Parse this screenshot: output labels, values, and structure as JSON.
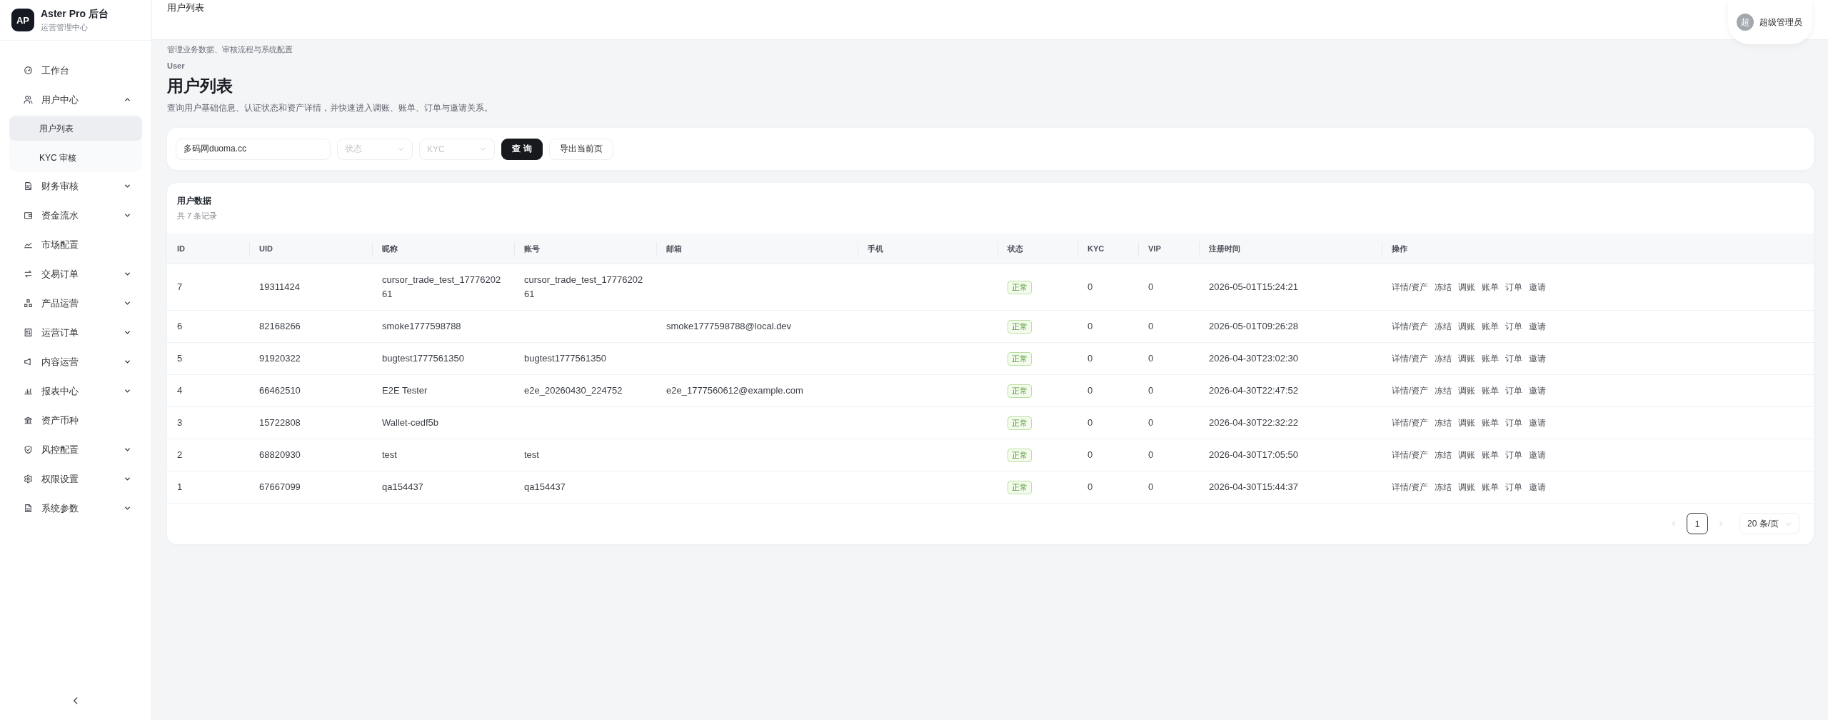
{
  "sidebar": {
    "logo": "AP",
    "title": "Aster Pro 后台",
    "subtitle": "运营管理中心",
    "items": [
      {
        "label": "工作台",
        "kind": "link",
        "selected": false
      },
      {
        "label": "用户中心",
        "kind": "group",
        "expanded": true,
        "selected": false,
        "children": [
          {
            "label": "用户列表",
            "selected": true
          },
          {
            "label": "KYC 审核",
            "selected": false
          }
        ]
      },
      {
        "label": "财务审核",
        "kind": "group",
        "expanded": false,
        "selected": false
      },
      {
        "label": "资金流水",
        "kind": "group",
        "expanded": false,
        "selected": false
      },
      {
        "label": "市场配置",
        "kind": "link",
        "selected": false
      },
      {
        "label": "交易订单",
        "kind": "group",
        "expanded": false,
        "selected": false
      },
      {
        "label": "产品运营",
        "kind": "group",
        "expanded": false,
        "selected": false
      },
      {
        "label": "运营订单",
        "kind": "group",
        "expanded": false,
        "selected": false
      },
      {
        "label": "内容运营",
        "kind": "group",
        "expanded": false,
        "selected": false
      },
      {
        "label": "报表中心",
        "kind": "group",
        "expanded": false,
        "selected": false
      },
      {
        "label": "资产币种",
        "kind": "link",
        "selected": false
      },
      {
        "label": "风控配置",
        "kind": "group",
        "expanded": false,
        "selected": false
      },
      {
        "label": "权限设置",
        "kind": "group",
        "expanded": false,
        "selected": false
      },
      {
        "label": "系统参数",
        "kind": "group",
        "expanded": false,
        "selected": false
      }
    ]
  },
  "header": {
    "title": "用户列表",
    "user": {
      "avatar": "超",
      "name": "超级管理员"
    }
  },
  "page": {
    "subtitle": "管理业务数据、审核流程与系统配置",
    "eyebrow": "User",
    "title": "用户列表",
    "description": "查询用户基础信息、认证状态和资产详情，并快速进入调账、账单、订单与邀请关系。"
  },
  "filters": {
    "search": {
      "value": "多码网duoma.cc"
    },
    "selects": [
      {
        "placeholder": "状态"
      },
      {
        "placeholder": "KYC"
      }
    ],
    "buttons": [
      {
        "label": "查 询",
        "kind": "primary"
      },
      {
        "label": "导出当前页",
        "kind": "default"
      }
    ]
  },
  "table": {
    "title": "用户数据",
    "count": "共 7 条记录",
    "columns": [
      "ID",
      "UID",
      "昵称",
      "账号",
      "邮箱",
      "手机",
      "状态",
      "KYC",
      "VIP",
      "注册时间",
      "操作"
    ],
    "rows": [
      {
        "id": "7",
        "uid": "19311424",
        "nickname": "cursor_trade_test_1777620261",
        "account": "cursor_trade_test_1777620261",
        "status": "正常",
        "kyc": "0",
        "vip": "0",
        "registered": "2026-05-01T15:24:21",
        "actions": [
          "详情/资产",
          "冻结",
          "调账",
          "账单",
          "订单",
          "邀请"
        ]
      },
      {
        "id": "6",
        "uid": "82168266",
        "nickname": "smoke1777598788",
        "email": "smoke1777598788@local.dev",
        "status": "正常",
        "kyc": "0",
        "vip": "0",
        "registered": "2026-05-01T09:26:28",
        "actions": [
          "详情/资产",
          "冻结",
          "调账",
          "账单",
          "订单",
          "邀请"
        ]
      },
      {
        "id": "5",
        "uid": "91920322",
        "nickname": "bugtest1777561350",
        "account": "bugtest1777561350",
        "status": "正常",
        "kyc": "0",
        "vip": "0",
        "registered": "2026-04-30T23:02:30",
        "actions": [
          "详情/资产",
          "冻结",
          "调账",
          "账单",
          "订单",
          "邀请"
        ]
      },
      {
        "id": "4",
        "uid": "66462510",
        "nickname": "E2E Tester",
        "account": "e2e_20260430_224752",
        "email": "e2e_1777560612@example.com",
        "status": "正常",
        "kyc": "0",
        "vip": "0",
        "registered": "2026-04-30T22:47:52",
        "actions": [
          "详情/资产",
          "冻结",
          "调账",
          "账单",
          "订单",
          "邀请"
        ]
      },
      {
        "id": "3",
        "uid": "15722808",
        "nickname": "Wallet-cedf5b",
        "status": "正常",
        "kyc": "0",
        "vip": "0",
        "registered": "2026-04-30T22:32:22",
        "actions": [
          "详情/资产",
          "冻结",
          "调账",
          "账单",
          "订单",
          "邀请"
        ]
      },
      {
        "id": "2",
        "uid": "68820930",
        "nickname": "test",
        "account": "test",
        "status": "正常",
        "kyc": "0",
        "vip": "0",
        "registered": "2026-04-30T17:05:50",
        "actions": [
          "详情/资产",
          "冻结",
          "调账",
          "账单",
          "订单",
          "邀请"
        ]
      },
      {
        "id": "1",
        "uid": "67667099",
        "nickname": "qa154437",
        "account": "qa154437",
        "status": "正常",
        "kyc": "0",
        "vip": "0",
        "registered": "2026-04-30T15:44:37",
        "actions": [
          "详情/资产",
          "冻结",
          "调账",
          "账单",
          "订单",
          "邀请"
        ]
      }
    ]
  },
  "pagination": {
    "prev": {
      "disabled": true
    },
    "pages": [
      {
        "label": "1",
        "selected": true
      }
    ],
    "next": {
      "disabled": true
    },
    "page_size": "20 条/页"
  }
}
